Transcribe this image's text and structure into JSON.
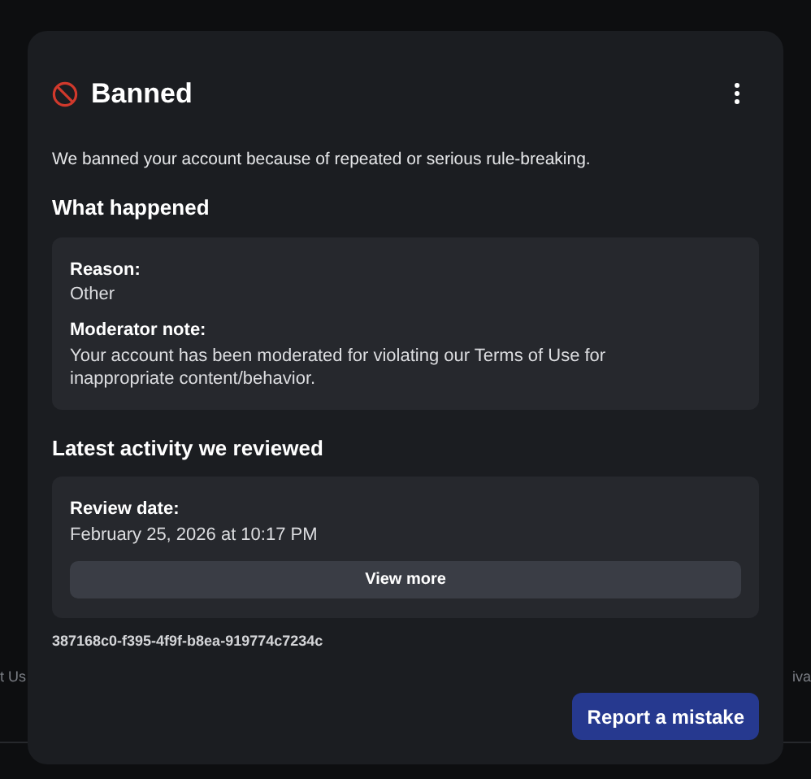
{
  "background": {
    "footer_links": [
      "t Us",
      "iva"
    ]
  },
  "dialog": {
    "title": "Banned",
    "intro": "We banned your account because of repeated or serious rule-breaking.",
    "sections": [
      {
        "heading": "What happened",
        "fields": [
          {
            "label": "Reason:",
            "value": "Other"
          },
          {
            "label": "Moderator note:",
            "value": "Your account has been moderated for violating our Terms of Use for inappropriate content/behavior."
          }
        ]
      },
      {
        "heading": "Latest activity we reviewed",
        "fields": [
          {
            "label": "Review date:",
            "value": "February 25, 2026 at 10:17 PM"
          }
        ],
        "button": "View more"
      }
    ],
    "reference_id": "387168c0-f395-4f9f-b8ea-919774c7234c",
    "primary_button": "Report a mistake"
  }
}
